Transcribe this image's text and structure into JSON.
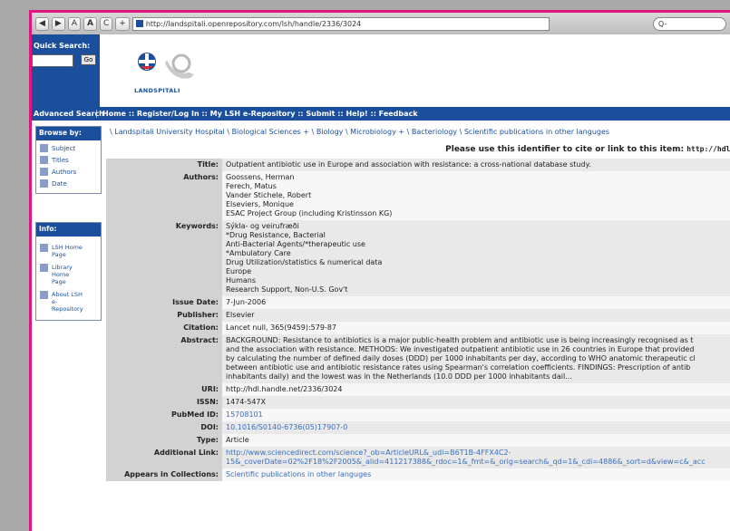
{
  "browser": {
    "back": "◀",
    "forward": "▶",
    "text_small": "A",
    "text_large": "A",
    "reload": "C",
    "add": "+",
    "url": "http://landspitali.openrepository.com/lsh/handle/2336/3024",
    "search_placeholder": "Q-"
  },
  "quick_search": {
    "label": "Quick Search:",
    "go": "Go"
  },
  "logo_text": "LANDSPITALI",
  "nav": {
    "advanced_search": "Advanced Search",
    "links": "Home :: Register/Log In :: My LSH e-Repository :: Submit :: Help! :: Feedback"
  },
  "browse": {
    "title": "Browse by:",
    "items": [
      "Subject",
      "Titles",
      "Authors",
      "Date"
    ]
  },
  "info": {
    "title": "Info:",
    "items": [
      [
        "LSH Home",
        "Page"
      ],
      [
        "Library",
        "Home",
        "Page"
      ],
      [
        "About LSH",
        "e-",
        "Repository"
      ]
    ]
  },
  "breadcrumb": "\\ Landspitali University Hospital \\ Biological Sciences + \\ Biology \\ Microbiology + \\ Bacteriology \\ Scientific publications in other languges",
  "identifier_text": "Please use this identifier to cite or link to this item:",
  "identifier_url": "http://hdl.h",
  "record": {
    "title_label": "Title:",
    "title": "Outpatient antibiotic use in Europe and association with resistance: a cross-national database study.",
    "authors_label": "Authors:",
    "authors": [
      "Goossens, Herman",
      "Ferech, Matus",
      "Vander Stichele, Robert",
      "Elseviers, Monique",
      "ESAC Project Group (including Kristinsson KG)"
    ],
    "keywords_label": "Keywords:",
    "keywords": [
      "Sýkla- og veirufræði",
      "*Drug Resistance, Bacterial",
      "Anti-Bacterial Agents/*therapeutic use",
      "*Ambulatory Care",
      "Drug Utilization/statistics & numerical data",
      "Europe",
      "Humans",
      "Research Support, Non-U.S. Gov't"
    ],
    "issue_date_label": "Issue Date:",
    "issue_date": "7-Jun-2006",
    "publisher_label": "Publisher:",
    "publisher": "Elsevier",
    "citation_label": "Citation:",
    "citation": "Lancet null, 365(9459):579-87",
    "abstract_label": "Abstract:",
    "abstract": [
      "BACKGROUND: Resistance to antibiotics is a major public-health problem and antibiotic use is being increasingly recognised as t",
      "and the association with resistance. METHODS: We investigated outpatient antibiotic use in 26 countries in Europe that provided",
      "by calculating the number of defined daily doses (DDD) per 1000 inhabitants per day, according to WHO anatomic therapeutic cl",
      "between antibiotic use and antibiotic resistance rates using Spearman's correlation coefficients. FINDINGS: Prescription of antib",
      "inhabitants daily) and the lowest was in the Netherlands (10.0 DDD per 1000 inhabitants dail..."
    ],
    "uri_label": "URI:",
    "uri": "http://hdl.handle.net/2336/3024",
    "issn_label": "ISSN:",
    "issn": "1474-547X",
    "pubmed_label": "PubMed ID:",
    "pubmed": "15708101",
    "doi_label": "DOI:",
    "doi": "10.1016/S0140-6736(05)17907-0",
    "type_label": "Type:",
    "type": "Article",
    "additional_link_label": "Additional Link:",
    "additional_link": [
      "http://www.sciencedirect.com/science?_ob=ArticleURL&_udi=B6T1B-4FFX4C2-",
      "15&_coverDate=02%2F18%2F2005&_alid=411217388&_rdoc=1&_fmt=&_orig=search&_qd=1&_cdi=4886&_sort=d&view=c&_acc"
    ],
    "collections_label": "Appears in Collections:",
    "collections": "Scientific publications in other languges"
  }
}
